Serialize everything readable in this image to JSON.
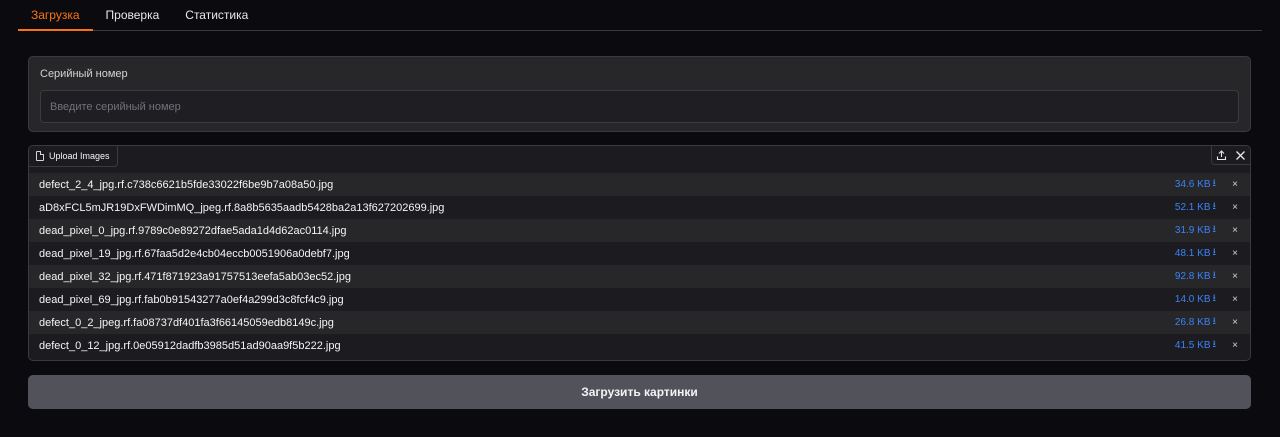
{
  "tabs": [
    {
      "label": "Загрузка",
      "active": true
    },
    {
      "label": "Проверка",
      "active": false
    },
    {
      "label": "Статистика",
      "active": false
    }
  ],
  "serial": {
    "label": "Серийный номер",
    "placeholder": "Введите серийный номер",
    "value": ""
  },
  "upload": {
    "tag_label": "Upload Images",
    "tag_icon": "file-icon",
    "actions": [
      "upload-icon",
      "close-icon"
    ],
    "files": [
      {
        "name": "defect_2_4_jpg.rf.c738c6621b5fde33022f6be9b7a08a50.jpg",
        "size": "34.6 KB"
      },
      {
        "name": "aD8xFCL5mJR19DxFWDimMQ_jpeg.rf.8a8b5635aadb5428ba2a13f627202699.jpg",
        "size": "52.1 KB"
      },
      {
        "name": "dead_pixel_0_jpg.rf.9789c0e89272dfae5ada1d4d62ac0114.jpg",
        "size": "31.9 KB"
      },
      {
        "name": "dead_pixel_19_jpg.rf.67faa5d2e4cb04eccb0051906a0debf7.jpg",
        "size": "48.1 KB"
      },
      {
        "name": "dead_pixel_32_jpg.rf.471f871923a91757513eefa5ab03ec52.jpg",
        "size": "92.8 KB"
      },
      {
        "name": "dead_pixel_69_jpg.rf.fab0b91543277a0ef4a299d3c8fcf4c9.jpg",
        "size": "14.0 KB"
      },
      {
        "name": "defect_0_2_jpeg.rf.fa08737df401fa3f66145059edb8149c.jpg",
        "size": "26.8 KB"
      },
      {
        "name": "defect_0_12_jpg.rf.0e05912dadfb3985d51ad90aa9f5b222.jpg",
        "size": "41.5 KB"
      }
    ],
    "download_glyph": "⭳",
    "remove_glyph": "×"
  },
  "submit": {
    "label": "Загрузить картинки"
  },
  "colors": {
    "accent": "#f97316",
    "link": "#3b82f6",
    "panel": "#27272a",
    "background": "#0b0b0f"
  }
}
